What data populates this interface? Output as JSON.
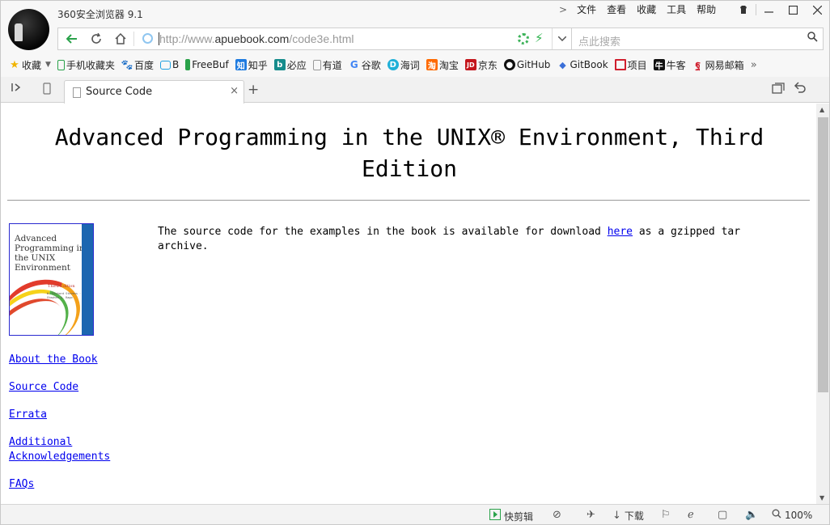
{
  "app": {
    "title": "360安全浏览器 9.1"
  },
  "menu": {
    "file": "文件",
    "view": "查看",
    "favorites": "收藏",
    "tools": "工具",
    "help": "帮助"
  },
  "address": {
    "url_domain_prefix": "http://www.",
    "url_domain": "apuebook.com",
    "url_path": "/code3e.html"
  },
  "search": {
    "placeholder": "点此搜索"
  },
  "bookmarks": {
    "favorites_label": "收藏",
    "items": [
      {
        "label": "手机收藏夹",
        "icon": "phone-icon"
      },
      {
        "label": "百度",
        "icon": "baidu-paw-icon"
      },
      {
        "label": "B",
        "icon": "bilibili-tv-icon"
      },
      {
        "label": "FreeBuf",
        "icon": "freebuf-icon"
      },
      {
        "label": "知乎",
        "icon": "zhihu-icon"
      },
      {
        "label": "必应",
        "icon": "bing-icon"
      },
      {
        "label": "有道",
        "icon": "page-icon"
      },
      {
        "label": "谷歌",
        "icon": "google-g-icon"
      },
      {
        "label": "海词",
        "icon": "dict-d-icon"
      },
      {
        "label": "淘宝",
        "icon": "taobao-icon"
      },
      {
        "label": "京东",
        "icon": "jd-icon"
      },
      {
        "label": "GitHub",
        "icon": "github-icon"
      },
      {
        "label": "GitBook",
        "icon": "gitbook-icon"
      },
      {
        "label": "项目",
        "icon": "project-icon"
      },
      {
        "label": "牛客",
        "icon": "nowcoder-icon"
      },
      {
        "label": "网易邮箱",
        "icon": "netease-mail-icon"
      }
    ]
  },
  "tab": {
    "title": "Source Code"
  },
  "page": {
    "heading": "Advanced Programming in the UNIX® Environment, Third Edition",
    "cover": {
      "title": "Advanced Programming in the UNIX Environment",
      "edition": "Third Edition",
      "authors": "W. Richard Stevens · Stephen A. Rago"
    },
    "nav": [
      {
        "label": "About the Book"
      },
      {
        "label": "Source Code"
      },
      {
        "label": "Errata"
      },
      {
        "label": "Additional Acknowledgements"
      },
      {
        "label": "FAQs"
      }
    ],
    "body_before": "The source code for the examples in the book is available for download ",
    "body_link": "here",
    "body_after": " as a gzipped tar archive."
  },
  "status": {
    "quick_clip": "快剪辑",
    "download": "下载",
    "zoom": "100%"
  },
  "colors": {
    "link": "#0000ee",
    "accent_green": "#2aa24a",
    "cover_border": "#2a2ad0"
  }
}
